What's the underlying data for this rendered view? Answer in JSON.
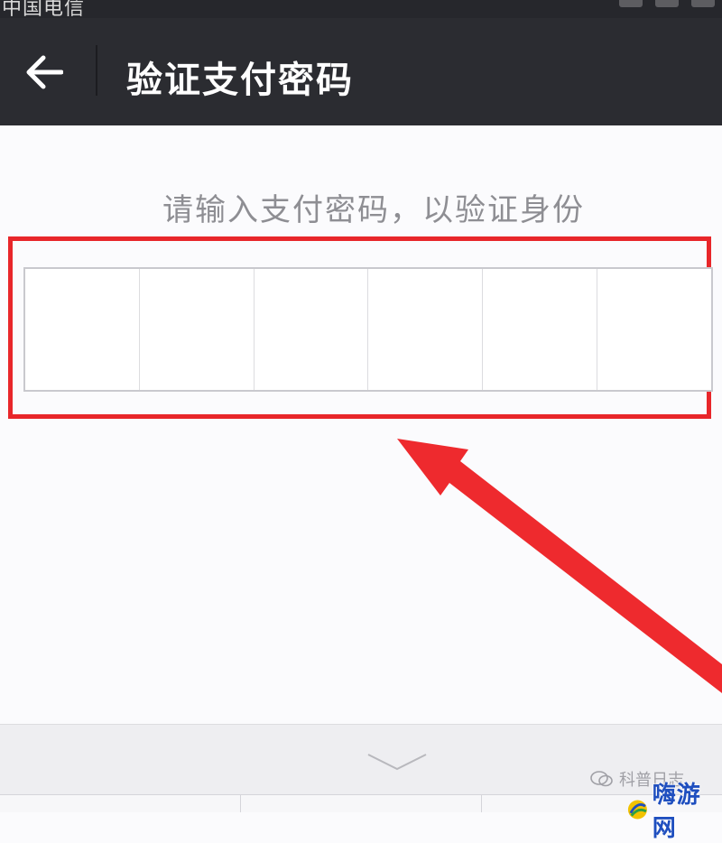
{
  "status_bar": {
    "carrier": "中国电信"
  },
  "header": {
    "title": "验证支付密码",
    "back_icon": "back-arrow-icon"
  },
  "main": {
    "prompt": "请输入支付密码，以验证身份",
    "password_digits": 6,
    "highlight_color": "#e8262a"
  },
  "keyboard": {
    "collapse_icon": "chevron-down-icon"
  },
  "watermark": {
    "source": "科普日志",
    "site": "嗨游网"
  }
}
